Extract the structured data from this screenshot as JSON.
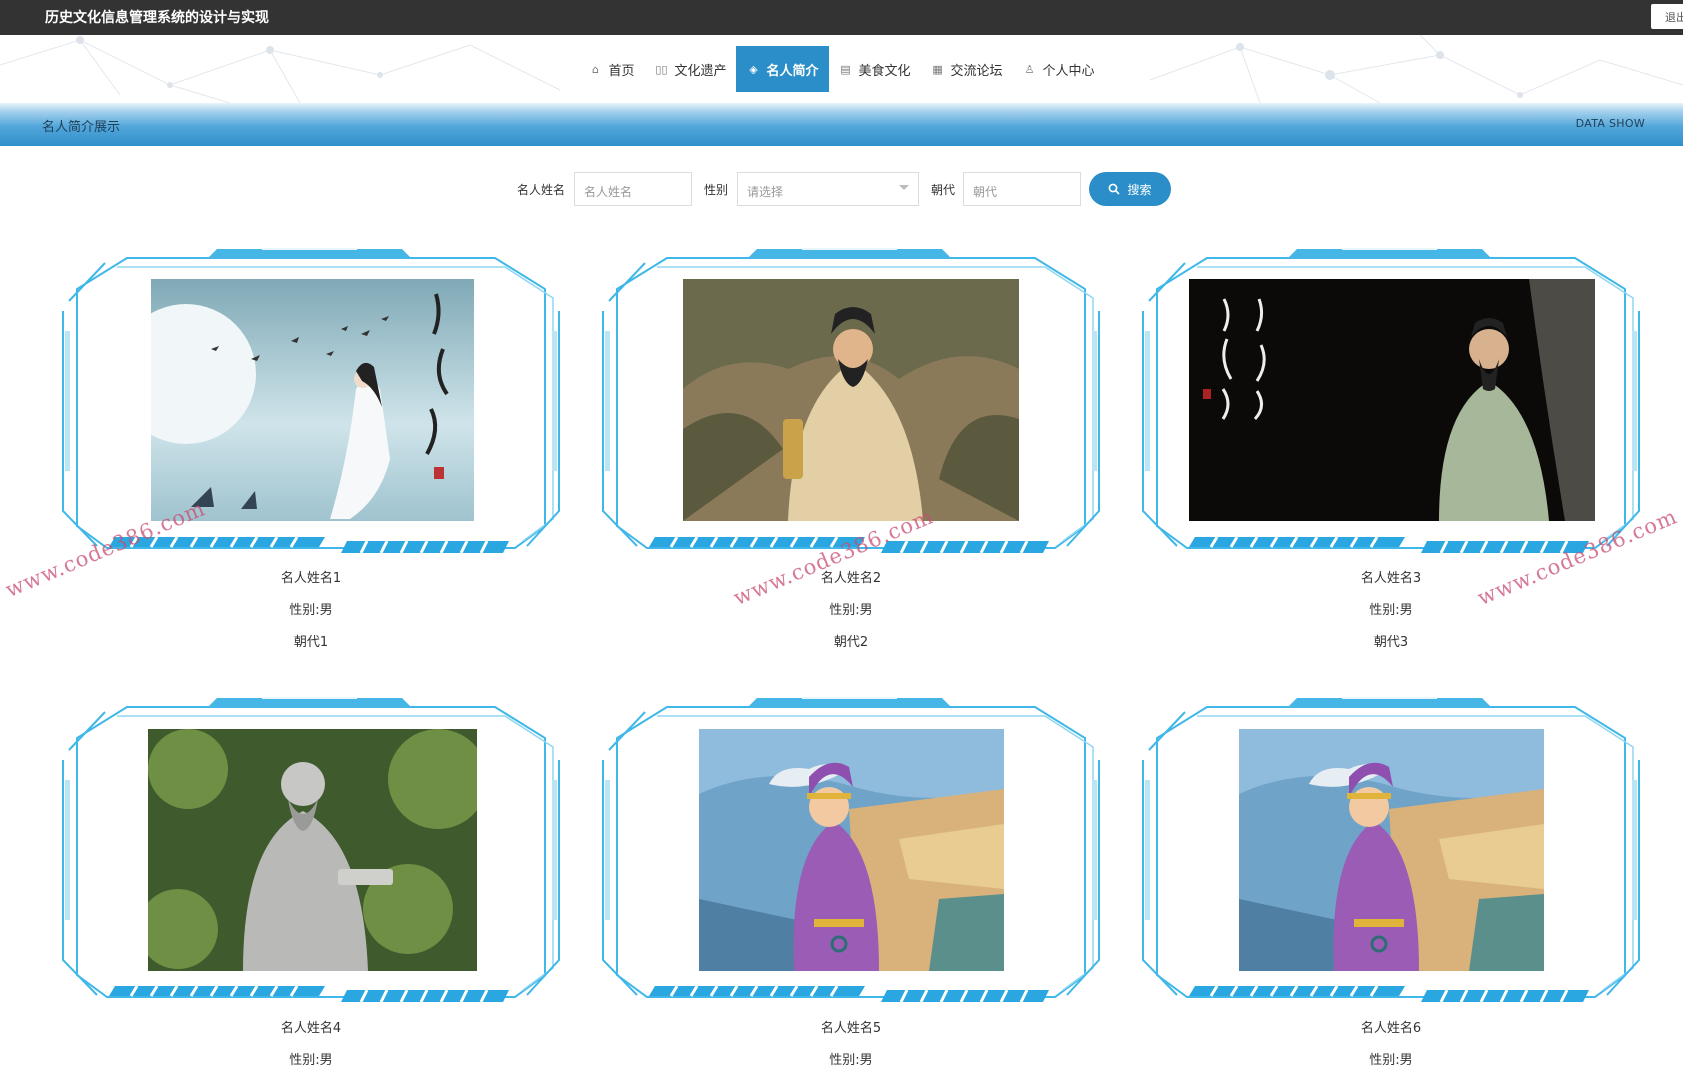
{
  "header": {
    "title": "历史文化信息管理系统的设计与实现",
    "logout_label": "退出"
  },
  "nav": {
    "items": [
      {
        "label": "首页",
        "icon": "home-icon",
        "glyph": "⌂",
        "active": false
      },
      {
        "label": "文化遗产",
        "icon": "grid-icon",
        "glyph": "▯▯",
        "active": false
      },
      {
        "label": "名人简介",
        "icon": "layers-icon",
        "glyph": "◈",
        "active": true
      },
      {
        "label": "美食文化",
        "icon": "calendar-icon",
        "glyph": "▤",
        "active": false
      },
      {
        "label": "交流论坛",
        "icon": "apps-icon",
        "glyph": "▦",
        "active": false
      },
      {
        "label": "个人中心",
        "icon": "user-icon",
        "glyph": "♙",
        "active": false
      }
    ]
  },
  "section": {
    "title": "名人简介展示",
    "subtitle": "DATA SHOW"
  },
  "search": {
    "name_label": "名人姓名",
    "name_placeholder": "名人姓名",
    "gender_label": "性别",
    "gender_value": "请选择",
    "dynasty_label": "朝代",
    "dynasty_placeholder": "朝代",
    "button_label": "搜索"
  },
  "cards": [
    {
      "name": "名人姓名1",
      "gender": "性别:男",
      "dynasty": "朝代1",
      "image": "poet-under-moon"
    },
    {
      "name": "名人姓名2",
      "gender": "性别:男",
      "dynasty": "朝代2",
      "image": "seated-scholar-painting"
    },
    {
      "name": "名人姓名3",
      "gender": "性别:男",
      "dynasty": "朝代3",
      "image": "actor-with-calligraphy"
    },
    {
      "name": "名人姓名4",
      "gender": "性别:男",
      "dynasty": "",
      "image": "stone-statue"
    },
    {
      "name": "名人姓名5",
      "gender": "性别:男",
      "dynasty": "",
      "image": "cartoon-poet"
    },
    {
      "name": "名人姓名6",
      "gender": "性别:男",
      "dynasty": "",
      "image": "cartoon-poet"
    }
  ],
  "watermark": "www.code386.com",
  "colors": {
    "topbar": "#333333",
    "accent": "#2b8ec8",
    "frame": "#3fb7e8"
  }
}
